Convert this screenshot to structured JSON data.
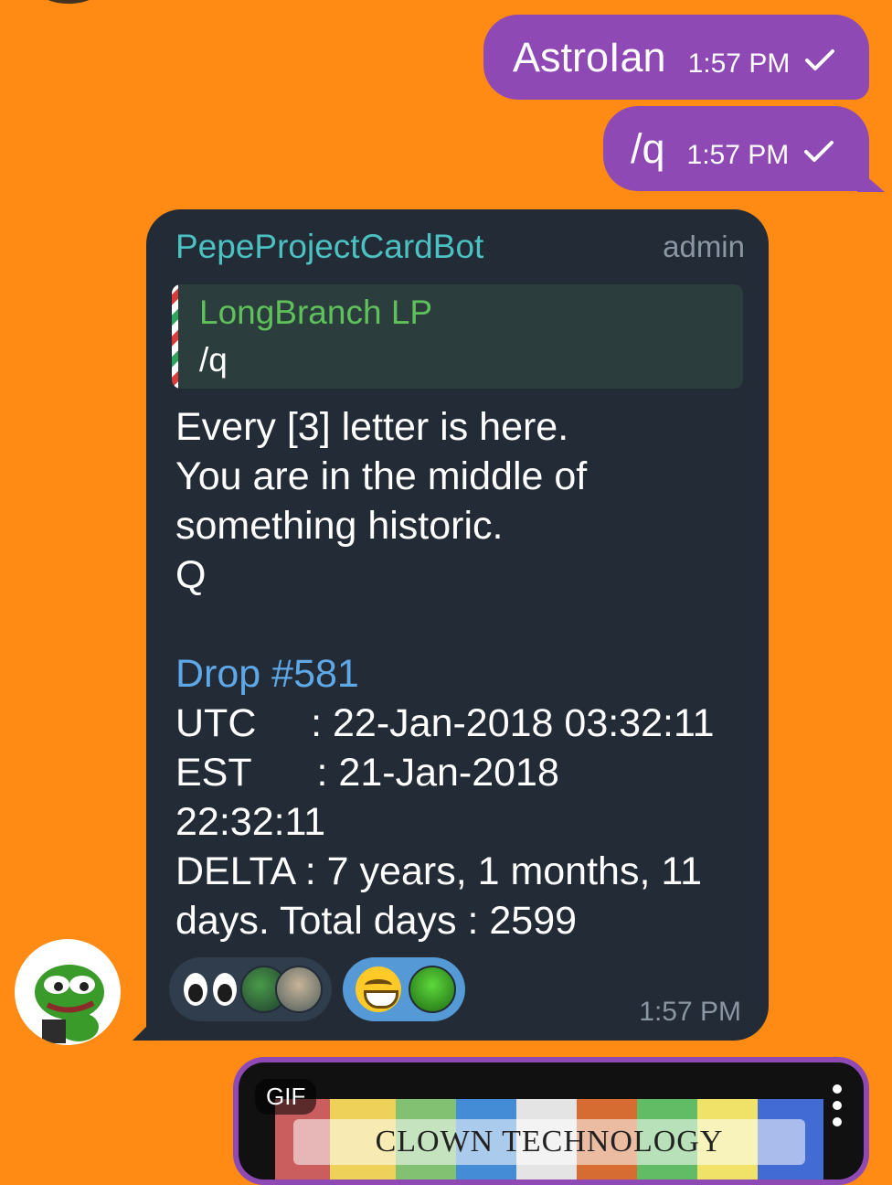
{
  "colors": {
    "background": "#FF8A14",
    "outgoing_bubble": "#8E49B5",
    "card_bg": "#222B36",
    "sender_name": "#4BC1C1",
    "reply_name": "#5FC15A",
    "link": "#5EA8E8"
  },
  "outgoing": [
    {
      "text": "AstroIan",
      "time": "1:57 PM",
      "status_icon": "check-icon"
    },
    {
      "text": "/q",
      "time": "1:57 PM",
      "status_icon": "check-icon"
    }
  ],
  "bot_message": {
    "sender": "PepeProjectCardBot",
    "role_badge": "admin",
    "reply": {
      "name": "LongBranch LP",
      "text": "/q"
    },
    "lines_before": "Every [3] letter is here.\nYou are in the middle of\nsomething historic.\nQ\n",
    "drop_link": "Drop #581",
    "lines_after": "UTC     : 22-Jan-2018 03:32:11\nEST      : 21-Jan-2018\n22:32:11\nDELTA : 7 years, 1 months, 11\ndays. Total days : 2599",
    "time": "1:57 PM",
    "reactions": [
      {
        "emoji": "eyes-emoji",
        "avatars": [
          "avatar-pepe",
          "avatar-person"
        ]
      },
      {
        "emoji": "grinning-face-emoji",
        "avatars": [
          "avatar-green-person"
        ]
      }
    ]
  },
  "gif_card": {
    "badge": "GIF",
    "title": "CLOWN TECHNOLOGY",
    "menu_icon": "more-vertical-icon"
  }
}
